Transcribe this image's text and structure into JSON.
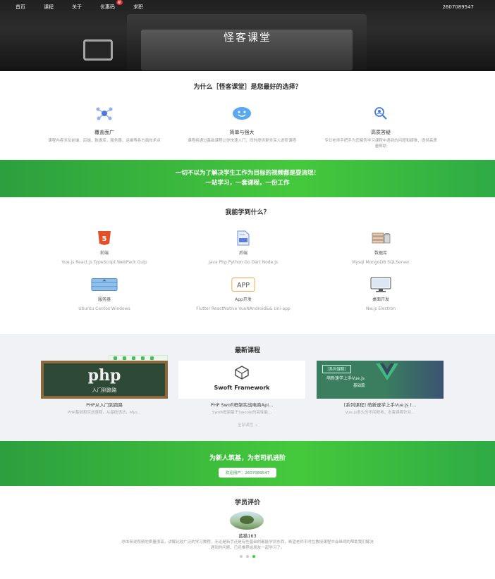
{
  "nav": {
    "items": [
      "首页",
      "课程",
      "关于",
      "优惠码",
      "求职"
    ],
    "badge": "新",
    "user": "2607089547"
  },
  "hero": {
    "title": "怪客课堂"
  },
  "why": {
    "title": "为什么［怪客课堂］是您最好的选择？",
    "features": [
      {
        "name": "覆盖面广",
        "desc": "课程内容涉及前端，后端，数据库，服务器，运维等各方面技术点"
      },
      {
        "name": "简单与强大",
        "desc": "课程将通过基础课程让你快速入门，同时提供更多深入进阶课程"
      },
      {
        "name": "高质答疑",
        "desc": "专业老师手把手为您解答学习课程中遇到的问题和疑难，提供高质量帮助"
      }
    ]
  },
  "band1": {
    "line1": "一切不以为了解决学生工作为目标的视频都是耍流氓！",
    "line2": "一站学习，一套课程，一份工作"
  },
  "learn": {
    "title": "我能学到什么？",
    "skills": [
      {
        "name": "前端",
        "desc": "Vue.js React.js TypeScript WebPack Gulp"
      },
      {
        "name": "后端",
        "desc": "Java Php Python Go Dart Node.js"
      },
      {
        "name": "数据库",
        "desc": "Mysql MongoDB SQLServer"
      },
      {
        "name": "服务器",
        "desc": "Ubuntu Centos Windows"
      },
      {
        "name": "App开发",
        "desc": "Flutter ReactNative VueNAndroid&& Uni-app"
      },
      {
        "name": "桌面开发",
        "desc": "Nw.js Electron"
      }
    ],
    "app_label": "APP"
  },
  "courses": {
    "title": "最新课程",
    "items": [
      {
        "title": "PHP从入门到跑路",
        "desc": "PHP基础和实战课程，从基础语法，Mys...",
        "thumb_big": "php",
        "thumb_small": "入门到跑路"
      },
      {
        "title": "PHP Swoft框架实战电商Api...",
        "desc": "Swoft框架基于Swoole的高性能...",
        "thumb_big": "Swoft Framework"
      },
      {
        "title": "[系列课程] 萌新速学上手Vue.js (...",
        "desc": "Vue.js多久的不间断地，本套课程针对...",
        "thumb_tag": "［系列课程］",
        "thumb_line1": "萌新速学上手Vue.js",
        "thumb_line2": "基础篇"
      }
    ],
    "more": "全部课程 →"
  },
  "band2": {
    "title": "为新人筑基，为老司机进阶",
    "button": "欢迎用户：2607089547"
  },
  "reviews": {
    "title": "学员评价",
    "name": "蓝猫163",
    "text": "总体来说视频的质量很高，讲解比较广泛的学习教程，无论是新手还是有些基础的都能学到东西，希望老师平时在教授课程中会继续的帮助我们解决遇到的问题，已经推荐给朋友一起学习了。"
  },
  "colors": {
    "green": "#45c93c",
    "dark_green": "#2c9f3e",
    "badge": "#e12a2a"
  }
}
